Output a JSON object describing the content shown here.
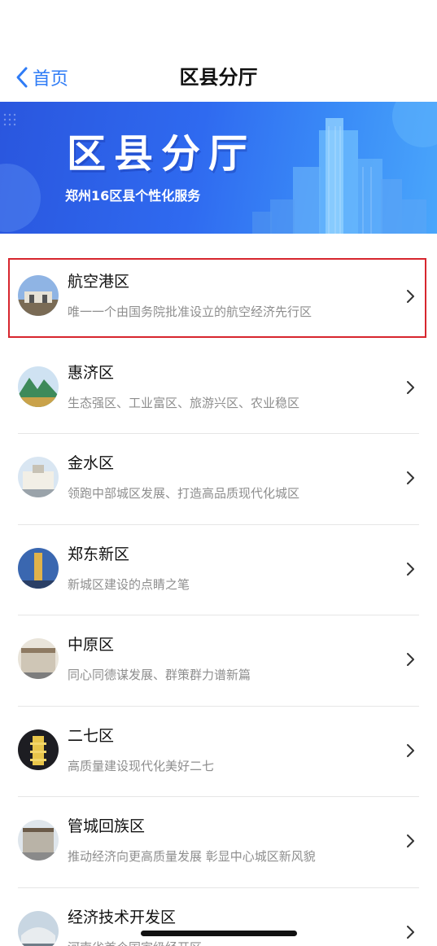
{
  "nav": {
    "back_label": "首页",
    "title": "区县分厅"
  },
  "banner": {
    "title": "区县分厅",
    "subtitle": "郑州16区县个性化服务"
  },
  "items": [
    {
      "name": "航空港区",
      "desc": "唯一一个由国务院批准设立的航空经济先行区",
      "icon": "airport-gate-photo-icon",
      "highlighted": true
    },
    {
      "name": "惠济区",
      "desc": "生态强区、工业富区、旅游兴区、农业稳区",
      "icon": "mountain-photo-icon"
    },
    {
      "name": "金水区",
      "desc": "领跑中部城区发展、打造高品质现代化城区",
      "icon": "building-photo-icon"
    },
    {
      "name": "郑东新区",
      "desc": "新城区建设的点睛之笔",
      "icon": "tower-photo-icon"
    },
    {
      "name": "中原区",
      "desc": "同心同德谋发展、群策群力谱新篇",
      "icon": "hall-photo-icon"
    },
    {
      "name": "二七区",
      "desc": "高质量建设现代化美好二七",
      "icon": "pagoda-photo-icon"
    },
    {
      "name": "管城回族区",
      "desc": "推动经济向更高质量发展 彰显中心城区新风貌",
      "icon": "museum-photo-icon"
    },
    {
      "name": "经济技术开发区",
      "desc": "河南省首个国家级经开区",
      "icon": "station-photo-icon"
    }
  ],
  "colors": {
    "accent": "#2f7cf6",
    "highlight_border": "#d7262e",
    "banner_start": "#2a56de",
    "banner_end": "#4aa6fb"
  }
}
